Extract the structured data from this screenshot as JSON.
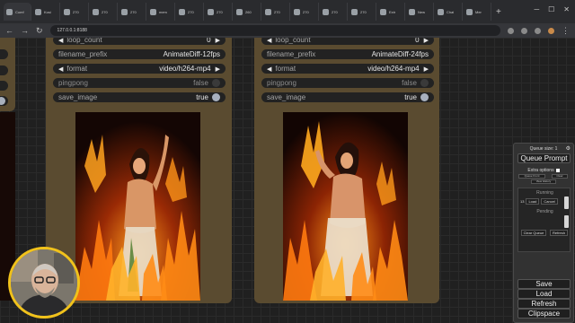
{
  "browser": {
    "tabs": [
      {
        "title": "Comf",
        "active": true
      },
      {
        "title": "Kosi"
      },
      {
        "title": "270"
      },
      {
        "title": "270"
      },
      {
        "title": "270"
      },
      {
        "title": "mem"
      },
      {
        "title": "270"
      },
      {
        "title": "270"
      },
      {
        "title": "260"
      },
      {
        "title": "270"
      },
      {
        "title": "270"
      },
      {
        "title": "270"
      },
      {
        "title": "270"
      },
      {
        "title": "Extr"
      },
      {
        "title": "New"
      },
      {
        "title": "Chat"
      },
      {
        "title": "Mer"
      }
    ],
    "url": "127.0.0.1:8188"
  },
  "node_a": {
    "widgets": {
      "loop_count": {
        "label": "loop_count",
        "value": "0"
      },
      "filename_prefix": {
        "label": "filename_prefix",
        "value": "AnimateDiff-12fps"
      },
      "format": {
        "label": "format",
        "value": "video/h264-mp4"
      },
      "pingpong": {
        "label": "pingpong",
        "value": "false"
      },
      "save_image": {
        "label": "save_image",
        "value": "true"
      }
    }
  },
  "node_b": {
    "widgets": {
      "loop_count": {
        "label": "loop_count",
        "value": "0"
      },
      "filename_prefix": {
        "label": "filename_prefix",
        "value": "AnimateDiff-24fps"
      },
      "format": {
        "label": "format",
        "value": "video/h264-mp4"
      },
      "pingpong": {
        "label": "pingpong",
        "value": "false"
      },
      "save_image": {
        "label": "save_image",
        "value": "true"
      }
    }
  },
  "queue_panel": {
    "queue_size_label": "Queue size: 1",
    "queue_prompt": "Queue Prompt",
    "extra_options": "Extra options",
    "queue_front": "Queue Front",
    "clear": "Clear",
    "view_history": "View History",
    "running_title": "Running",
    "running_number": "13",
    "load": "Load",
    "cancel": "Cancel",
    "pending_title": "Pending",
    "clear_queue": "Clear Queue",
    "refresh_small": "Refresh",
    "save": "Save",
    "load_big": "Load",
    "refresh": "Refresh",
    "clipspace": "Clipspace"
  },
  "colors": {
    "node_body": "#5a4b30",
    "widget_bg": "#222222",
    "canvas_bg": "#202020",
    "webcam_ring": "#f1c21b"
  }
}
